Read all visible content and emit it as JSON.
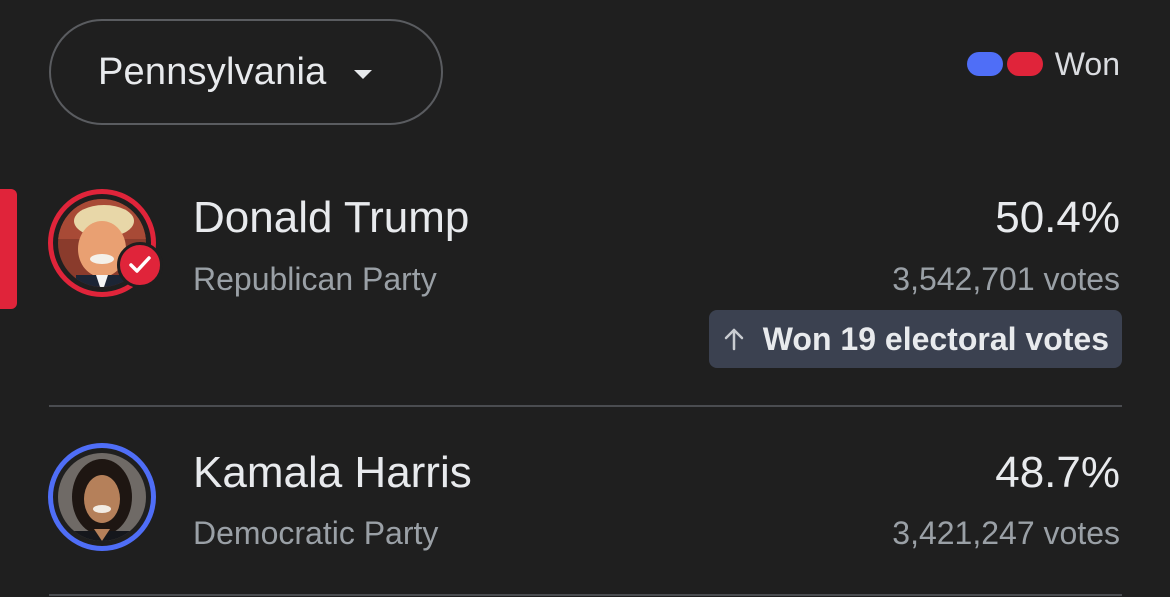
{
  "header": {
    "state_label": "Pennsylvania",
    "legend_label": "Won"
  },
  "colors": {
    "republican": "#e0243a",
    "democratic": "#4f6ef7",
    "background": "#1f1f1f"
  },
  "candidates": [
    {
      "name": "Donald Trump",
      "party": "Republican Party",
      "percent": "50.4%",
      "votes": "3,542,701 votes",
      "winner": true,
      "electoral_note": "Won 19 electoral votes"
    },
    {
      "name": "Kamala Harris",
      "party": "Democratic Party",
      "percent": "48.7%",
      "votes": "3,421,247 votes",
      "winner": false
    }
  ]
}
